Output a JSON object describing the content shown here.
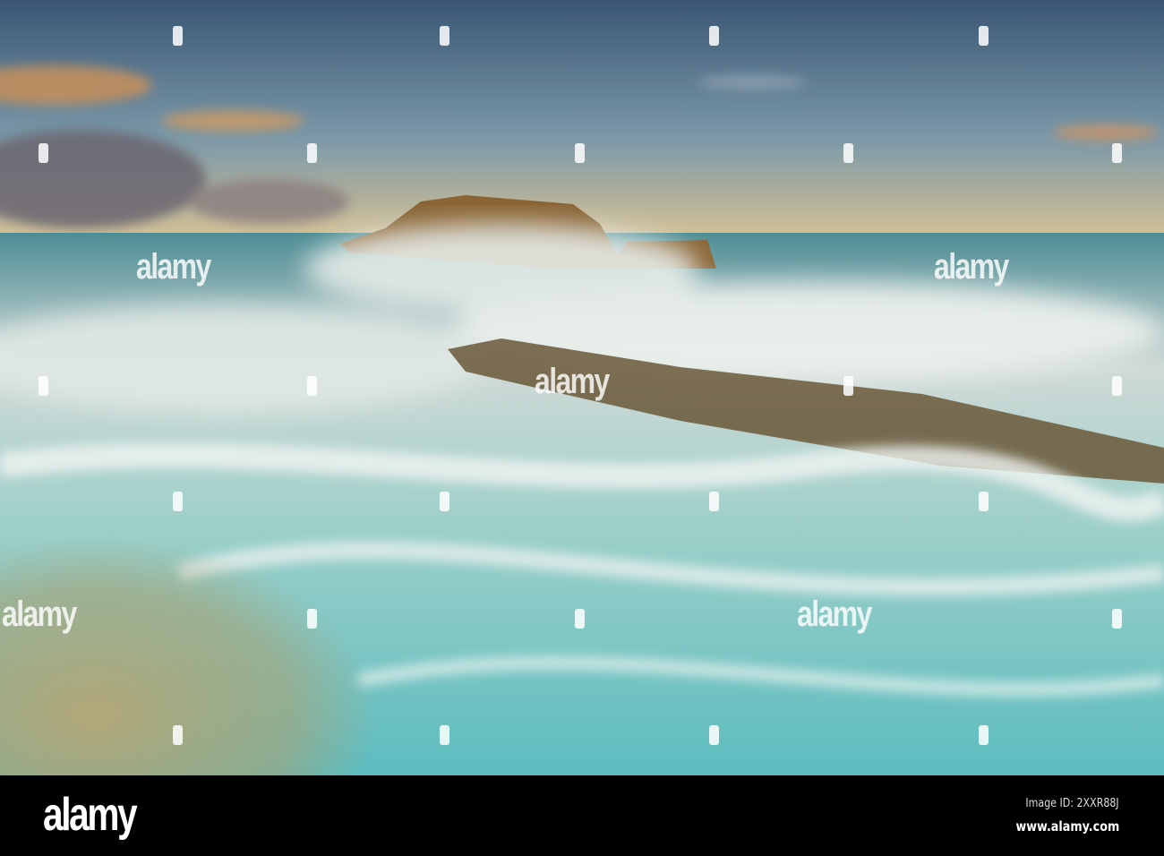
{
  "photo": {
    "watermark_text": "alamy",
    "colors": {
      "sky_top": "#3d5b78",
      "sky_horizon": "#e9c48e",
      "sea": "#3f8f96",
      "foam": "#e8eeea",
      "rock": "#8a6434",
      "teal": "#58b7b8",
      "sand": "#b3a474"
    }
  },
  "footer": {
    "logo": "alamy",
    "image_id": "Image ID: 2XXR88J",
    "url": "www.alamy.com"
  }
}
